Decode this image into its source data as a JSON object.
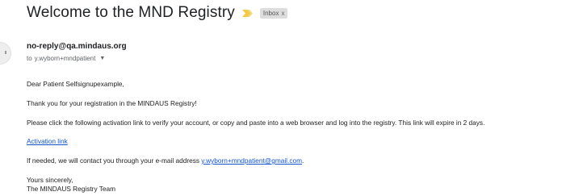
{
  "email": {
    "subject": "Welcome to the MND Registry",
    "label": "Inbox",
    "label_remove": "x",
    "sender": "no-reply@qa.mindaus.org",
    "to_prefix": "to",
    "recipient": "y.wyborn+mndpatient",
    "greeting": "Dear Patient Selfsignupexample,",
    "thanks": "Thank you for your registration in the MINDAUS Registry!",
    "instructions": "Please click the following activation link to verify your account, or copy and paste into a web browser and log into the registry. This link will expire in 2 days.",
    "activation_link": "Activation link",
    "contact_prefix": "If needed, we will contact you through your e-mail address",
    "contact_email": "y.wyborn+mndpatient@gmail.com",
    "contact_suffix": ".",
    "closing": "Yours sincerely,",
    "signature": "The MINDAUS Registry Team"
  },
  "colors": {
    "importance_marker": "#f2c94c",
    "link": "#1155cc",
    "label_chip_bg": "#dddddd"
  }
}
